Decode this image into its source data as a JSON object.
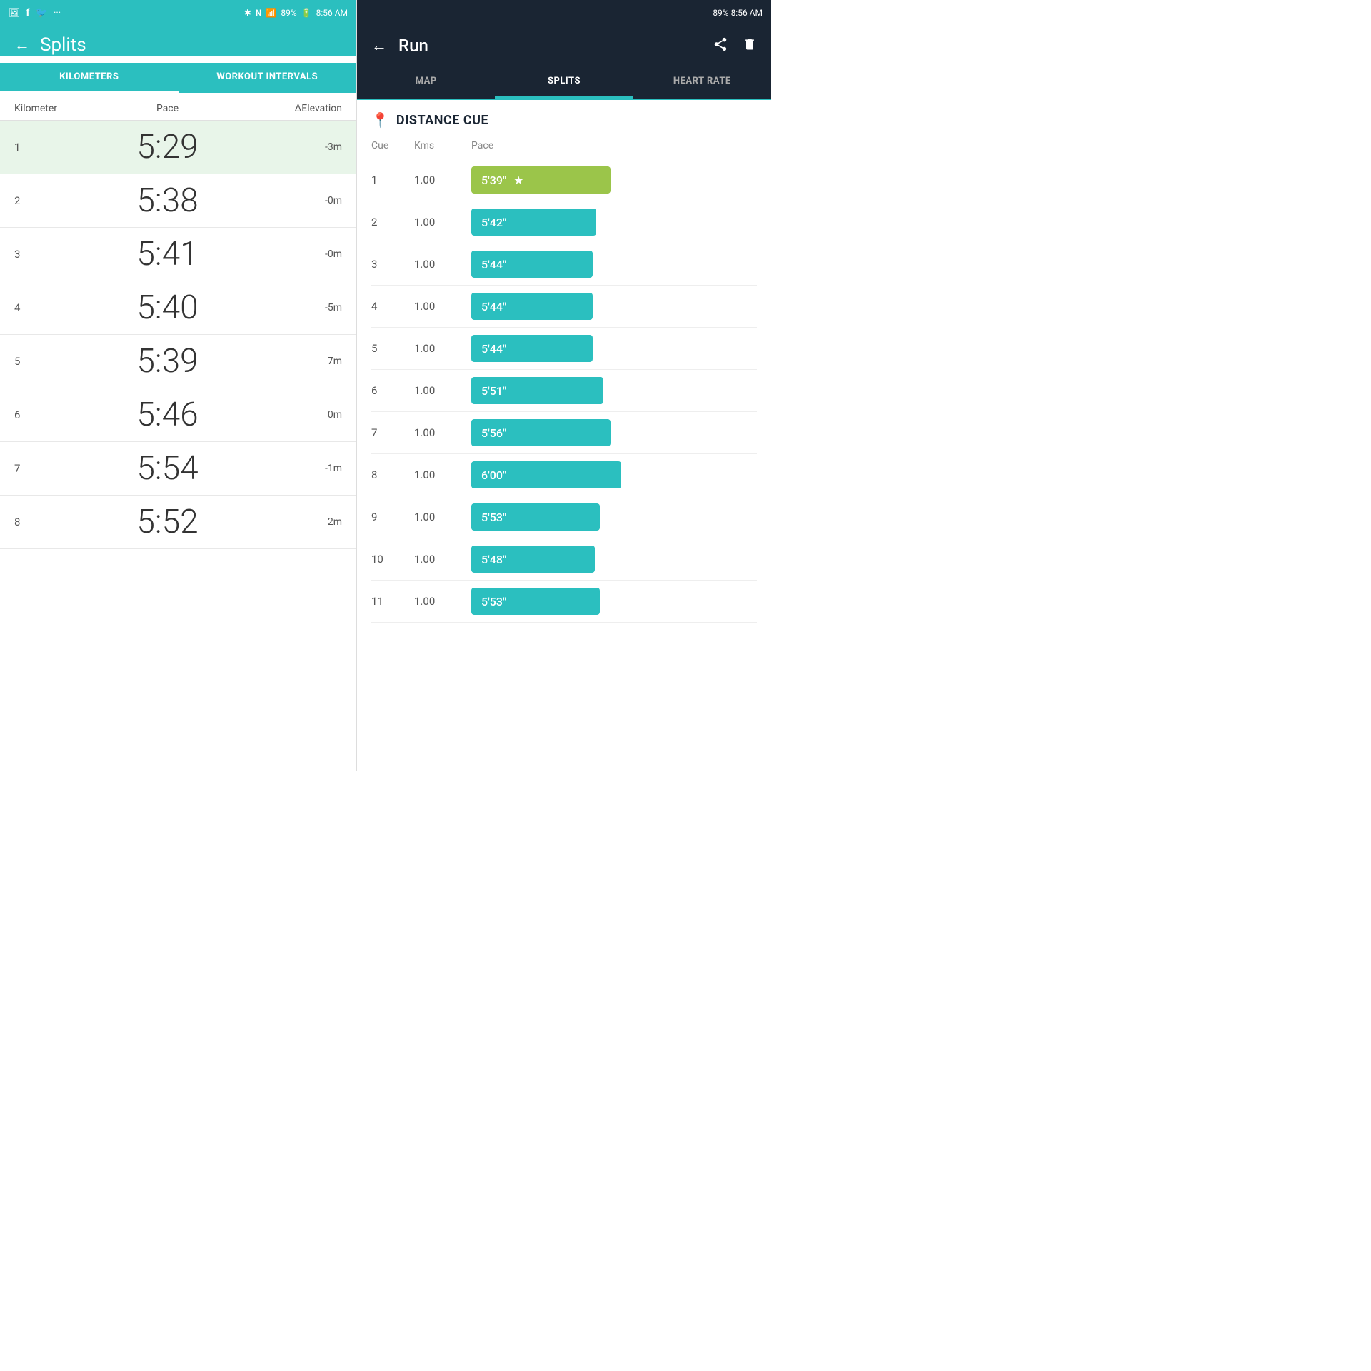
{
  "left": {
    "statusBar": {
      "icons": [
        "photo",
        "facebook",
        "twitter",
        "ellipsis"
      ],
      "rightIcons": [
        "bluetooth",
        "n-icon",
        "signal",
        "89%",
        "8:56 AM"
      ]
    },
    "title": "Splits",
    "tabs": [
      {
        "id": "kilometers",
        "label": "KILOMETERS",
        "active": false
      },
      {
        "id": "workout-intervals",
        "label": "WORKOUT INTERVALS",
        "active": true
      }
    ],
    "columns": {
      "km": "Kilometer",
      "pace": "Pace",
      "elevation": "ΔElevation"
    },
    "splits": [
      {
        "num": 1,
        "pace": "5:29",
        "elevation": "-3m",
        "highlighted": true
      },
      {
        "num": 2,
        "pace": "5:38",
        "elevation": "-0m",
        "highlighted": false
      },
      {
        "num": 3,
        "pace": "5:41",
        "elevation": "-0m",
        "highlighted": false
      },
      {
        "num": 4,
        "pace": "5:40",
        "elevation": "-5m",
        "highlighted": false
      },
      {
        "num": 5,
        "pace": "5:39",
        "elevation": "7m",
        "highlighted": false
      },
      {
        "num": 6,
        "pace": "5:46",
        "elevation": "0m",
        "highlighted": false
      },
      {
        "num": 7,
        "pace": "5:54",
        "elevation": "-1m",
        "highlighted": false
      },
      {
        "num": 8,
        "pace": "5:52",
        "elevation": "2m",
        "highlighted": false
      }
    ]
  },
  "right": {
    "statusBar": {
      "text": "89% 8:56 AM"
    },
    "title": "Run",
    "tabs": [
      {
        "id": "map",
        "label": "MAP",
        "active": false
      },
      {
        "id": "splits",
        "label": "SPLITS",
        "active": true
      },
      {
        "id": "heart-rate",
        "label": "HEART RATE",
        "active": false
      }
    ],
    "sectionTitle": "DISTANCE CUE",
    "columns": {
      "cue": "Cue",
      "kms": "Kms",
      "pace": "Pace"
    },
    "cues": [
      {
        "num": 1,
        "kms": "1.00",
        "pace": "5'39\"",
        "best": true
      },
      {
        "num": 2,
        "kms": "1.00",
        "pace": "5'42\"",
        "best": false
      },
      {
        "num": 3,
        "kms": "1.00",
        "pace": "5'44\"",
        "best": false
      },
      {
        "num": 4,
        "kms": "1.00",
        "pace": "5'44\"",
        "best": false
      },
      {
        "num": 5,
        "kms": "1.00",
        "pace": "5'44\"",
        "best": false
      },
      {
        "num": 6,
        "kms": "1.00",
        "pace": "5'51\"",
        "best": false
      },
      {
        "num": 7,
        "kms": "1.00",
        "pace": "5'56\"",
        "best": false
      },
      {
        "num": 8,
        "kms": "1.00",
        "pace": "6'00\"",
        "best": false
      },
      {
        "num": 9,
        "kms": "1.00",
        "pace": "5'53\"",
        "best": false
      },
      {
        "num": 10,
        "kms": "1.00",
        "pace": "5'48\"",
        "best": false
      },
      {
        "num": 11,
        "kms": "1.00",
        "pace": "5'53\"",
        "best": false
      }
    ],
    "paceBarlengths": [
      195,
      175,
      170,
      170,
      170,
      185,
      195,
      210,
      180,
      173,
      180
    ]
  }
}
